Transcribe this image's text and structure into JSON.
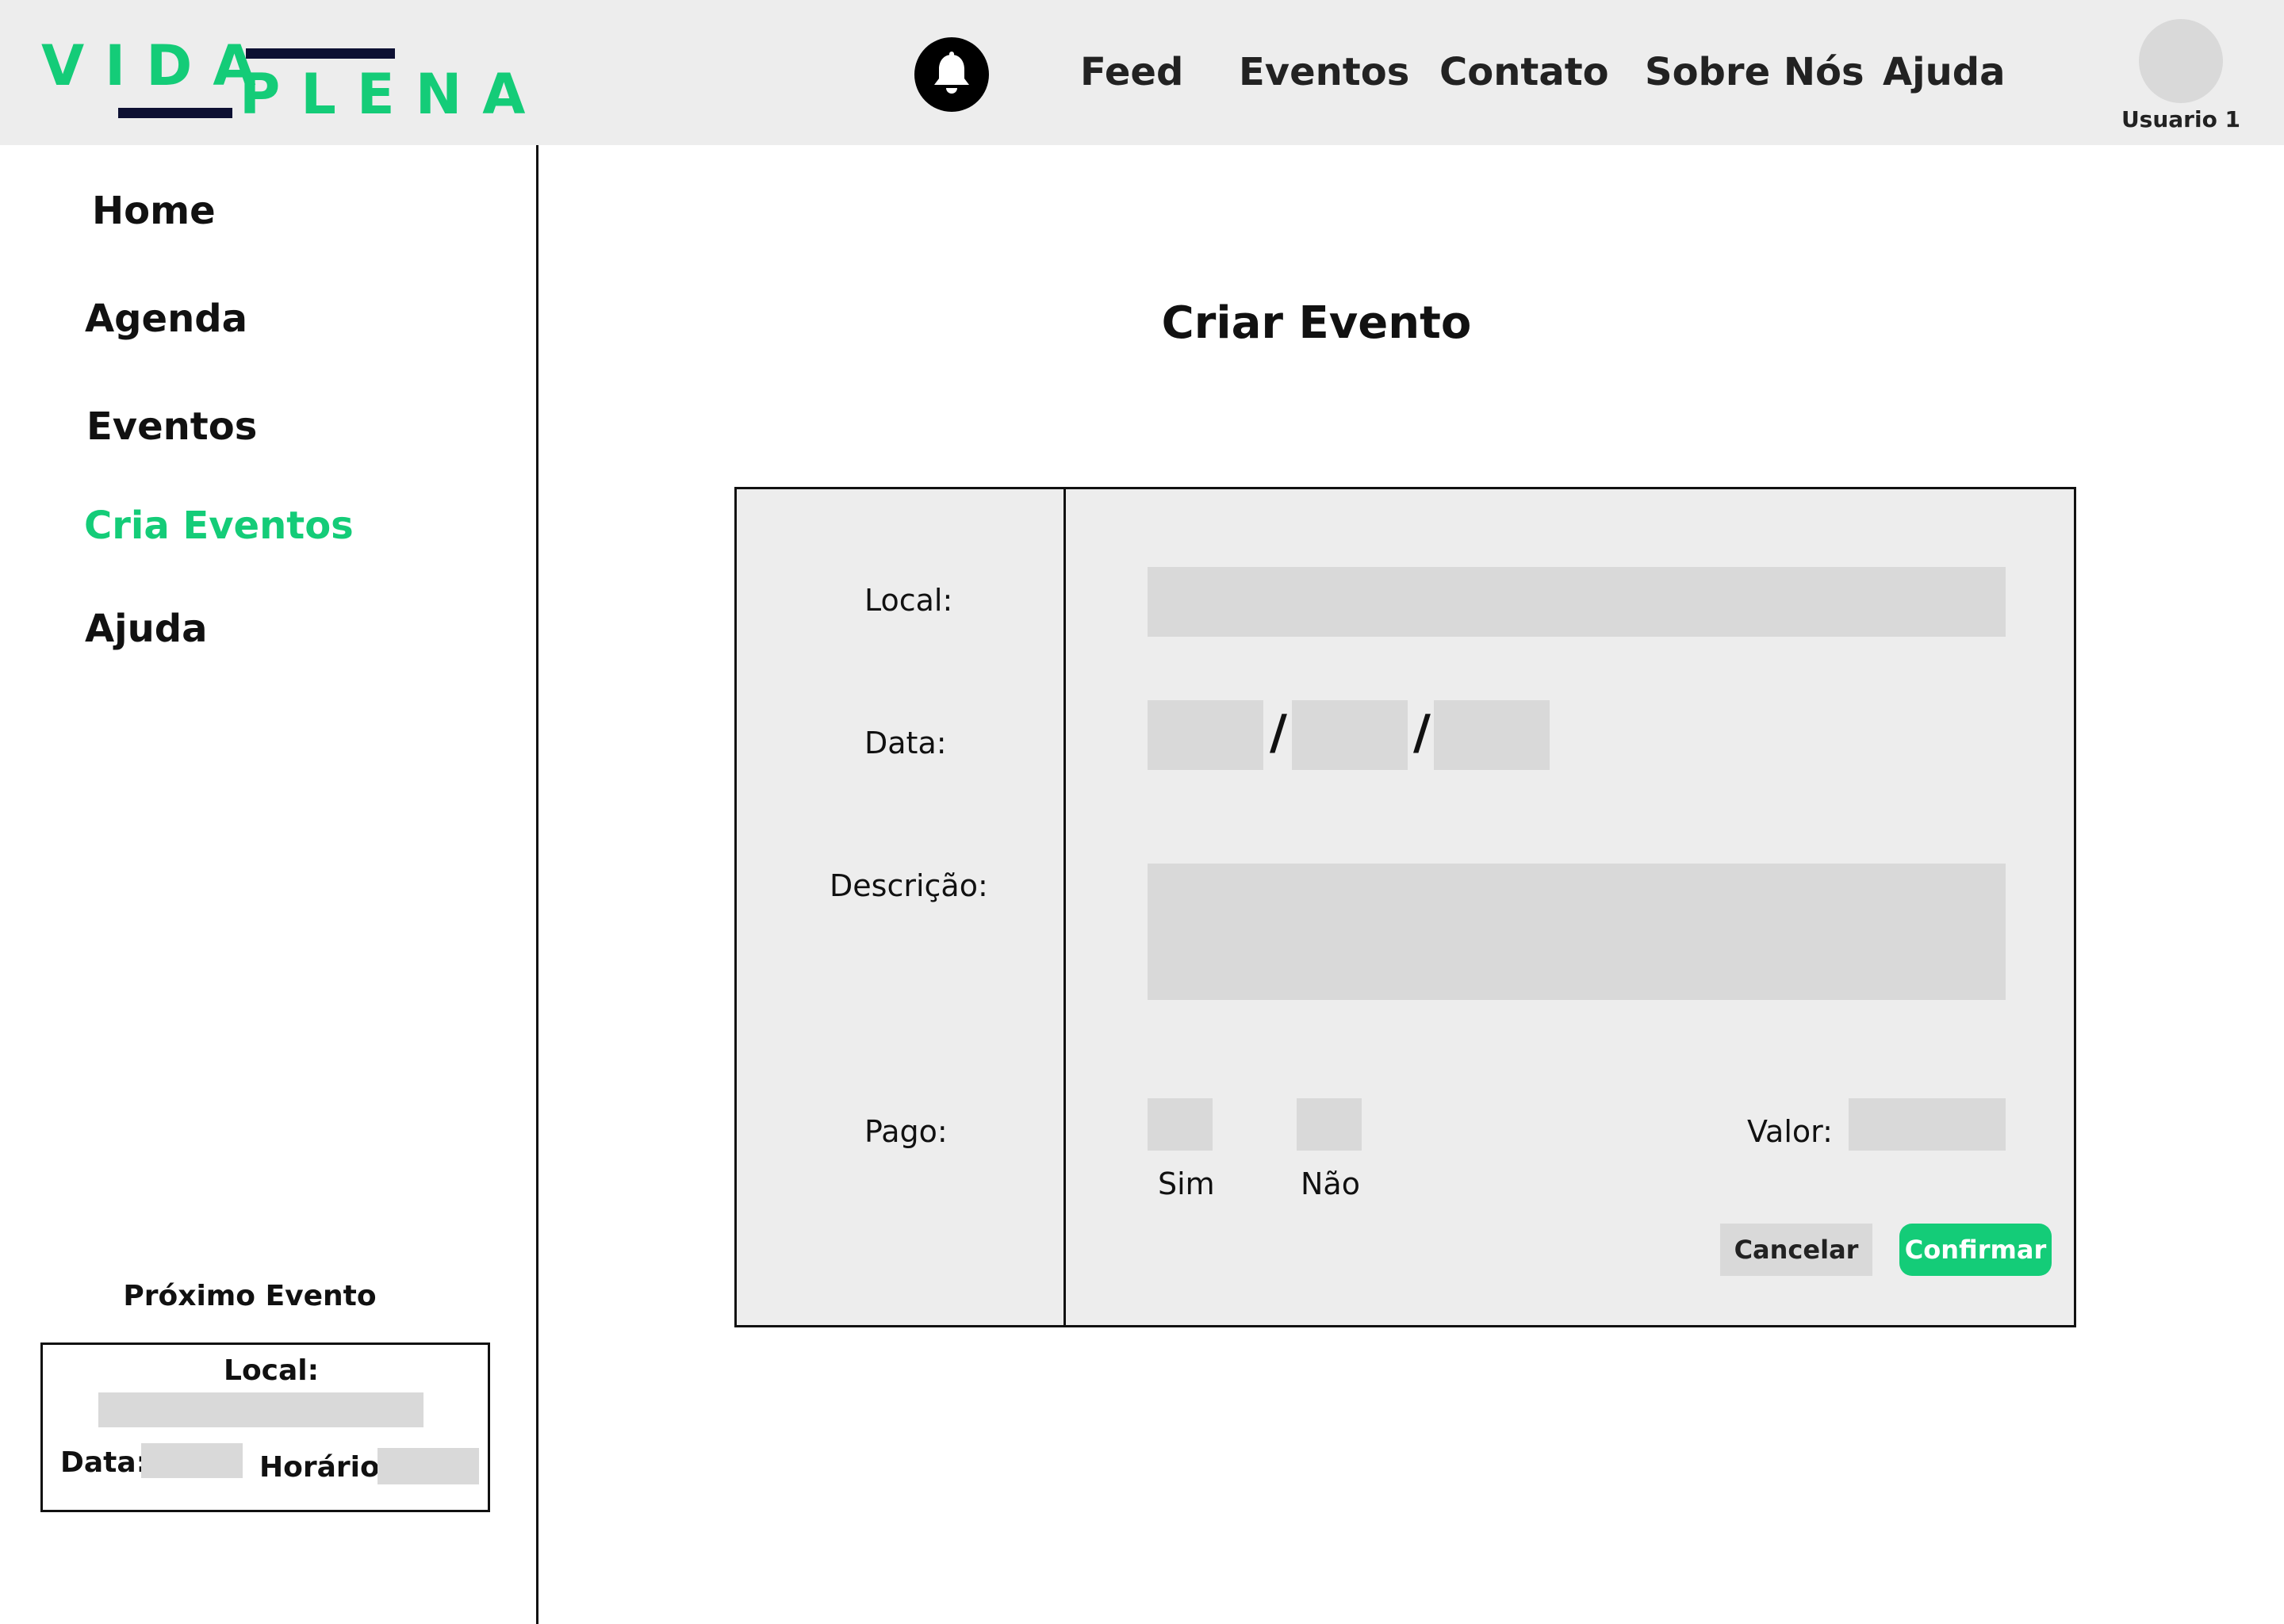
{
  "header": {
    "logo_top": "VIDA",
    "logo_bottom": "PLENA",
    "nav": [
      "Feed",
      "Eventos",
      "Contato",
      "Sobre Nós",
      "Ajuda"
    ],
    "user_name": "Usuario 1",
    "bell_icon": "bell-icon"
  },
  "sidebar": {
    "items": [
      {
        "label": "Home",
        "active": false
      },
      {
        "label": "Agenda",
        "active": false
      },
      {
        "label": "Eventos",
        "active": false
      },
      {
        "label": "Cria Eventos",
        "active": true
      },
      {
        "label": "Ajuda",
        "active": false
      }
    ],
    "next_event": {
      "title": "Próximo Evento",
      "local_label": "Local:",
      "data_label": "Data:",
      "horario_label": "Horário:"
    }
  },
  "main": {
    "title": "Criar Evento",
    "form": {
      "local_label": "Local:",
      "data_label": "Data:",
      "date_separator": "/",
      "descricao_label": "Descrição:",
      "pago_label": "Pago:",
      "sim_label": "Sim",
      "nao_label": "Não",
      "valor_label": "Valor:",
      "cancel_label": "Cancelar",
      "confirm_label": "Confirmar"
    }
  },
  "colors": {
    "accent": "#14cc78",
    "header_bg": "#ededed",
    "field_bg": "#d9d9d9",
    "logo_bar": "#0d1033"
  }
}
